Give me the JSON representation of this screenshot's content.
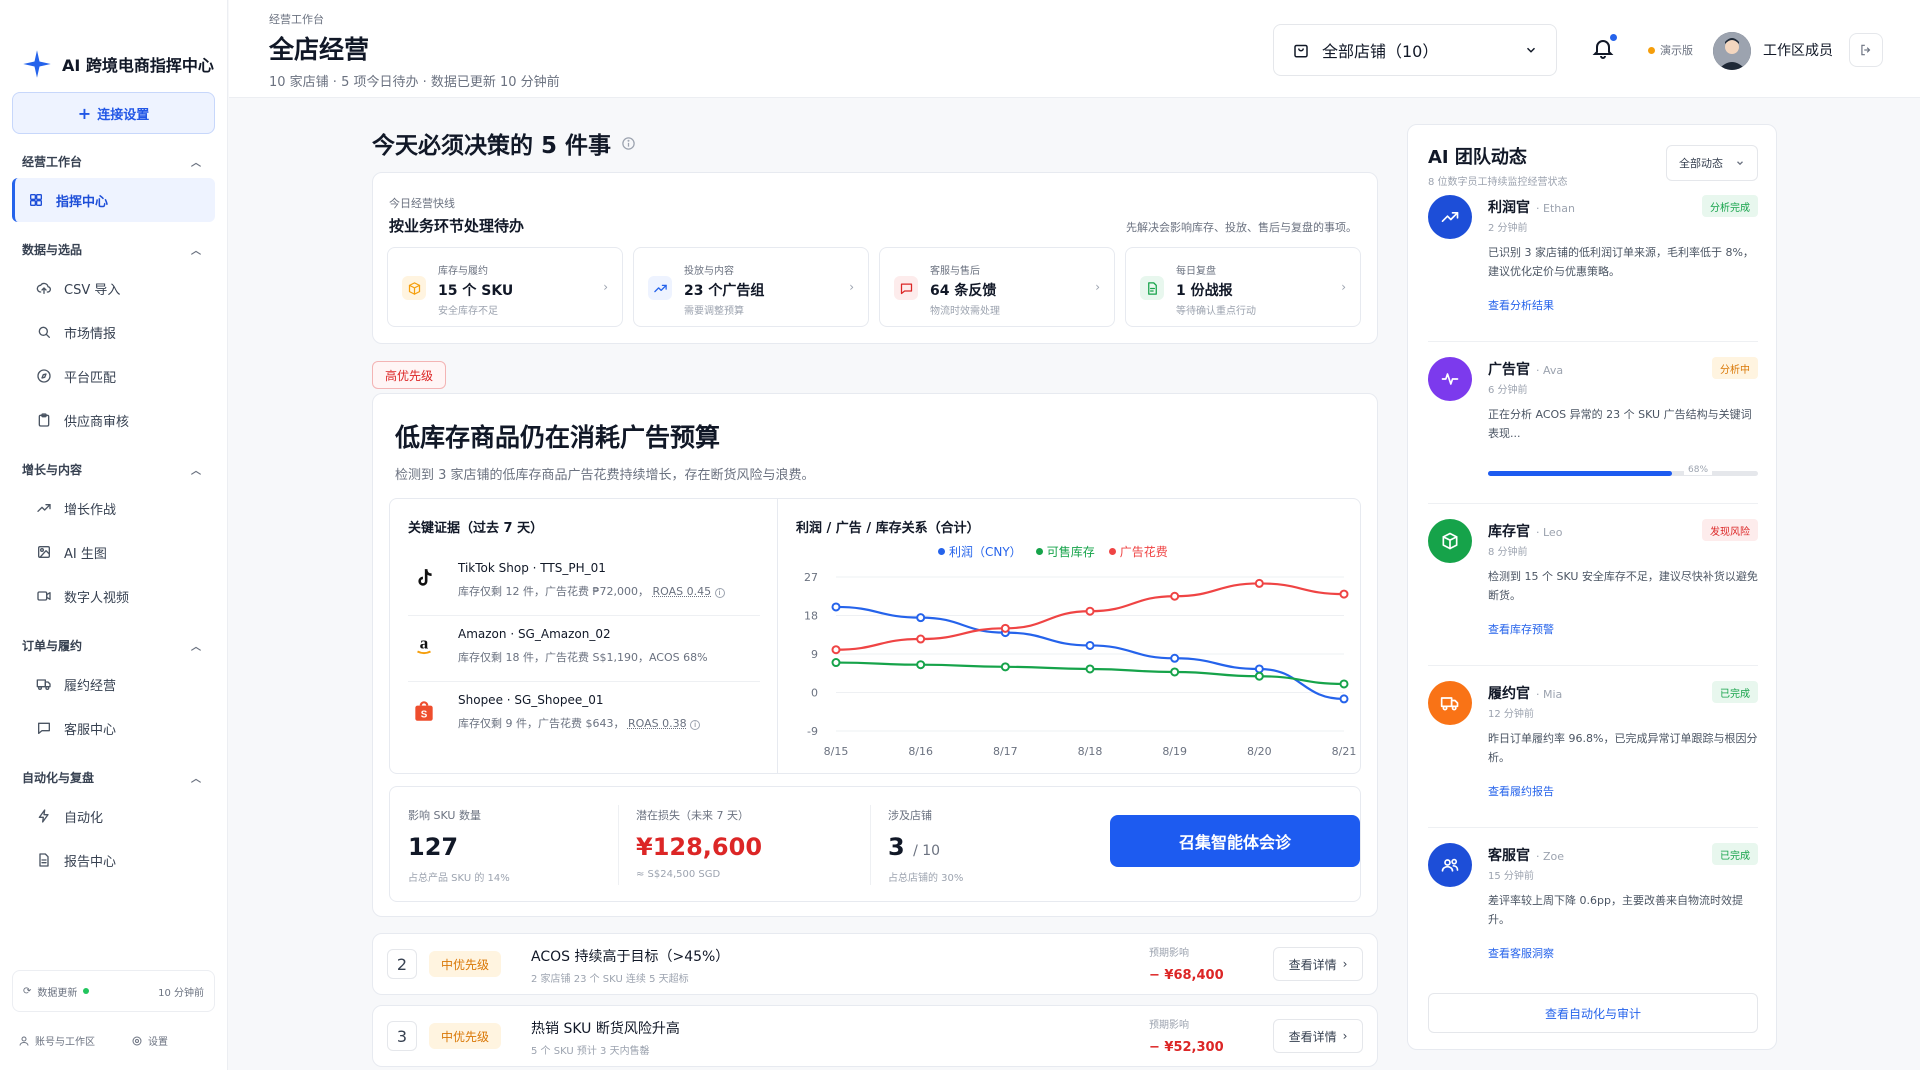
{
  "brand": {
    "name": "AI 跨境电商指挥中心"
  },
  "sidebar": {
    "connect_label": "连接设置",
    "groups": [
      {
        "title": "经营工作台",
        "items": [
          {
            "label": "指挥中心",
            "icon": "grid-icon",
            "active": true
          }
        ]
      },
      {
        "title": "数据与选品",
        "items": [
          {
            "label": "CSV 导入",
            "icon": "upload-icon"
          },
          {
            "label": "市场情报",
            "icon": "search-icon"
          },
          {
            "label": "平台匹配",
            "icon": "compass-icon"
          },
          {
            "label": "供应商审核",
            "icon": "clipboard-icon"
          }
        ]
      },
      {
        "title": "增长与内容",
        "items": [
          {
            "label": "增长作战",
            "icon": "trend-icon"
          },
          {
            "label": "AI 生图",
            "icon": "image-icon"
          },
          {
            "label": "数字人视频",
            "icon": "video-icon"
          }
        ]
      },
      {
        "title": "订单与履约",
        "items": [
          {
            "label": "履约经营",
            "icon": "truck-icon"
          },
          {
            "label": "客服中心",
            "icon": "chat-icon"
          }
        ]
      },
      {
        "title": "自动化与复盘",
        "items": [
          {
            "label": "自动化",
            "icon": "bolt-icon"
          },
          {
            "label": "报告中心",
            "icon": "file-icon"
          }
        ]
      }
    ],
    "data_update_label": "数据更新",
    "data_update_time": "10 分钟前",
    "account_label": "账号与工作区",
    "settings_label": "设置"
  },
  "header": {
    "breadcrumb": "经营工作台",
    "title": "全店经营",
    "subtitle": "10 家店铺 · 5 项今日待办 · 数据已更新 10 分钟前",
    "store_select": "全部店铺（10）",
    "demo_label": "演示版",
    "user_name": "工作区成员"
  },
  "main": {
    "section_title": "今天必须决策的 5 件事",
    "quick": {
      "caption": "今日经营快线",
      "title": "按业务环节处理待办",
      "note": "先解决会影响库存、投放、售后与复盘的事项。",
      "cards": [
        {
          "caption": "库存与履约",
          "main": "15 个 SKU",
          "sub": "安全库存不足",
          "icon": "box-icon",
          "color": "#f59e0b",
          "bg": "#fff4e0"
        },
        {
          "caption": "投放与内容",
          "main": "23 个广告组",
          "sub": "需要调整预算",
          "icon": "trend-icon",
          "color": "#2563eb",
          "bg": "#eef3ff"
        },
        {
          "caption": "客服与售后",
          "main": "64 条反馈",
          "sub": "物流时效需处理",
          "icon": "chat-icon",
          "color": "#dc2626",
          "bg": "#fdecec"
        },
        {
          "caption": "每日复盘",
          "main": "1 份战报",
          "sub": "等待确认重点行动",
          "icon": "report-icon",
          "color": "#16a34a",
          "bg": "#e8f7ee"
        }
      ]
    },
    "priority_tag": "高优先级",
    "card": {
      "title": "低库存商品仍在消耗广告预算",
      "desc": "检测到 3 家店铺的低库存商品广告花费持续增长，存在断货风险与浪费。",
      "evidence_title": "关键证据（过去 7 天）",
      "evidence": [
        {
          "name": "TikTok Shop · TTS_PH_01",
          "info": "库存仅剩 12 件，广告花费 ₱72,000，",
          "metric": "ROAS 0.45",
          "logo": "tiktok-logo"
        },
        {
          "name": "Amazon · SG_Amazon_02",
          "info": "库存仅剩 18 件，广告花费 S$1,190，ACOS 68%",
          "metric": "",
          "logo": "amazon-logo"
        },
        {
          "name": "Shopee · SG_Shopee_01",
          "info": "库存仅剩 9 件，广告花费 $643，",
          "metric": "ROAS 0.38",
          "logo": "shopee-logo"
        }
      ],
      "metrics": [
        {
          "caption": "影响 SKU 数量",
          "value": "127",
          "suffix": "",
          "note": "占总产品 SKU 的 14%"
        },
        {
          "caption": "潜在损失（未来 7 天）",
          "value": "¥128,600",
          "suffix": "",
          "note": "≈ S$24,500 SGD"
        },
        {
          "caption": "涉及店铺",
          "value": "3",
          "suffix": "/ 10",
          "note": "占总店铺的 30%"
        }
      ],
      "summon_button": "召集智能体会诊"
    },
    "tasks": [
      {
        "num": "2",
        "priority": "中优先级",
        "title": "ACOS 持续高于目标（>45%）",
        "sub": "2 家店铺 23 个 SKU 连续 5 天超标",
        "impact_caption": "预期影响",
        "impact": "− ¥68,400",
        "button": "查看详情"
      },
      {
        "num": "3",
        "priority": "中优先级",
        "title": "热销 SKU 断货风险升高",
        "sub": "5 个 SKU 预计 3 天内售罄",
        "impact_caption": "预期影响",
        "impact": "− ¥52,300",
        "button": "查看详情"
      }
    ]
  },
  "chart_data": {
    "type": "line",
    "title": "利润 / 广告 / 库存关系（合计）",
    "categories": [
      "8/15",
      "8/16",
      "8/17",
      "8/18",
      "8/19",
      "8/20",
      "8/21"
    ],
    "ylim": [
      -9,
      27
    ],
    "yticks": [
      27,
      18,
      9,
      0,
      -9
    ],
    "grid": true,
    "legend_position": "top-center",
    "series": [
      {
        "name": "利润（CNY）",
        "color": "#2563eb",
        "values": [
          20,
          17.5,
          14,
          11,
          8,
          5.5,
          -1.5
        ]
      },
      {
        "name": "可售库存",
        "color": "#16a34a",
        "values": [
          7,
          6.5,
          6,
          5.5,
          4.8,
          3.8,
          2
        ]
      },
      {
        "name": "广告花费",
        "color": "#ef4444",
        "values": [
          10,
          12.5,
          15,
          19,
          22.5,
          25.5,
          23
        ]
      }
    ]
  },
  "ai_panel": {
    "title": "AI 团队动态",
    "subtitle": "8 位数字员工持续监控经营状态",
    "filter": "全部动态",
    "agents": [
      {
        "name": "利润官",
        "person": "Ethan",
        "time": "2 分钟前",
        "status": "分析完成",
        "text": "已识别 3 家店铺的低利润订单来源，毛利率低于 8%，建议优化定价与优惠策略。",
        "link": "查看分析结果",
        "icon": "trend-up-icon",
        "color": "#1d4ed8",
        "status_color": "#16a34a",
        "status_bg": "#e8f7ee"
      },
      {
        "name": "广告官",
        "person": "Ava",
        "time": "6 分钟前",
        "status": "分析中",
        "text": "正在分析 ACOS 异常的 23 个 SKU 广告结构与关键词表现...",
        "link": "",
        "progress": 68,
        "progress_label": "68%",
        "icon": "pulse-icon",
        "color": "#7c3aed",
        "status_color": "#d97706",
        "status_bg": "#fff4e0"
      },
      {
        "name": "库存官",
        "person": "Leo",
        "time": "8 分钟前",
        "status": "发现风险",
        "text": "检测到 15 个 SKU 安全库存不足，建议尽快补货以避免断货。",
        "link": "查看库存预警",
        "icon": "cube-icon",
        "color": "#16a34a",
        "status_color": "#dc2626",
        "status_bg": "#fdecec"
      },
      {
        "name": "履约官",
        "person": "Mia",
        "time": "12 分钟前",
        "status": "已完成",
        "text": "昨日订单履约率 96.8%，已完成异常订单跟踪与根因分析。",
        "link": "查看履约报告",
        "icon": "truck-icon",
        "color": "#f97316",
        "status_color": "#16a34a",
        "status_bg": "#e8f7ee"
      },
      {
        "name": "客服官",
        "person": "Zoe",
        "time": "15 分钟前",
        "status": "已完成",
        "text": "差评率较上周下降 0.6pp，主要改善来自物流时效提升。",
        "link": "查看客服洞察",
        "icon": "users-icon",
        "color": "#1d4ed8",
        "status_color": "#16a34a",
        "status_bg": "#e8f7ee"
      }
    ],
    "audit_button": "查看自动化与审计"
  }
}
